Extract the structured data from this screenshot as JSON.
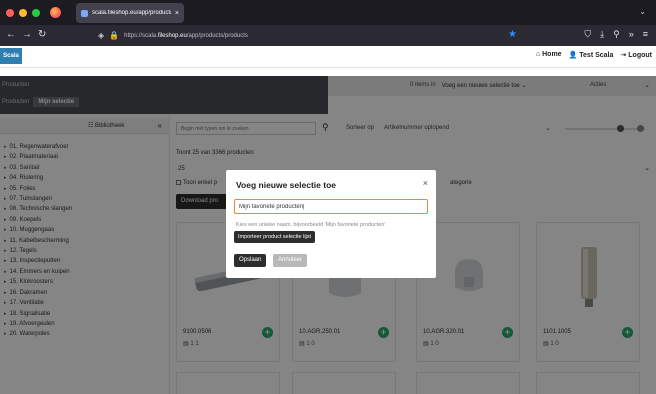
{
  "browser": {
    "tab_title": "scala.fileshop.eu/app/product/...",
    "tab_close": "×",
    "url_prefix": "https://scala.",
    "url_domain": "fileshop.eu",
    "url_path": "/app/products/products"
  },
  "app": {
    "logo": "Scala",
    "header_links": [
      {
        "icon": "⌂",
        "label": "Home"
      },
      {
        "icon": "👤",
        "label": "Test Scala"
      },
      {
        "icon": "⇥",
        "label": "Logout"
      }
    ]
  },
  "breadcrumbs": {
    "row1": "Producten",
    "row2_prefix": "Producten",
    "row2_active": "Mijn selectie"
  },
  "selection_bar": {
    "items_count": "0 items in",
    "target": "Voeg een nieuwe selectie toe",
    "actions": "Acties"
  },
  "sidebar": {
    "title": "Bibliotheek",
    "collapse": "«",
    "categories": [
      "01. Regenwaterafvoer",
      "02. Plaatmateriaal",
      "03. Sanitair",
      "04. Riolering",
      "05. Folies",
      "07. Tuinslangen",
      "08. Technische slangen",
      "09. Koepels",
      "10. Muggengaas",
      "11. Kabelbescherming",
      "12. Tegels",
      "13. Inspectieputten",
      "14. Emmers en kuipen",
      "15. Klokroosters",
      "16. Dakramen",
      "17. Ventilatie",
      "18. Signalisatie",
      "19. Afvoergeulen",
      "20. Waterpoles"
    ]
  },
  "main": {
    "search_placeholder": "Begin met typen om te zoeken",
    "sort_label": "Sorteer op",
    "sort_value": "Artikelnummer oplopend",
    "showing": "Toont 25 van 3366 producten",
    "per_page": "25",
    "show_all_label": "Toon enkel p",
    "category_label": "ategorie",
    "download_label": "Download pro",
    "products": [
      {
        "code": "9100.0506",
        "meta": "1  1"
      },
      {
        "code": "10.AGR.250.01",
        "meta": "1  0"
      },
      {
        "code": "10.AGR.320.01",
        "meta": "1  0"
      },
      {
        "code": "1101.1005",
        "meta": "1  0"
      }
    ]
  },
  "modal": {
    "title": "Voeg nieuwe selectie toe",
    "input_value": "Mijn favoriete producten|",
    "hint": "Kies een unieke naam, bijvoorbeeld 'Mijn favoriete producten'",
    "import_label": "Importeer product selectie lijst",
    "save_label": "Opslaan",
    "cancel_label": "Annuleer"
  }
}
